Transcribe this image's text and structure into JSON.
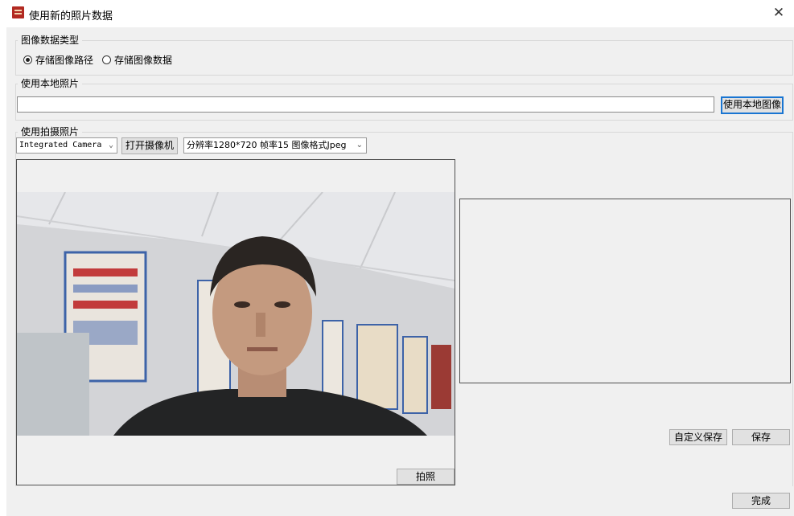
{
  "window": {
    "title": "使用新的照片数据",
    "close_glyph": "✕"
  },
  "image_type_group": {
    "legend": "图像数据类型",
    "options": [
      {
        "label": "存储图像路径",
        "checked": true
      },
      {
        "label": "存储图像数据",
        "checked": false
      }
    ]
  },
  "local_group": {
    "legend": "使用本地照片",
    "path_value": "",
    "button_label": "使用本地图像"
  },
  "capture_group": {
    "legend": "使用拍摄照片",
    "camera_select": "Integrated Camera",
    "open_camera_label": "打开摄像机",
    "format_select": "分辨率1280*720 帧率15 图像格式Jpeg",
    "capture_label": "拍照",
    "custom_save_label": "自定义保存",
    "save_label": "保存"
  },
  "footer": {
    "done_label": "完成"
  },
  "icons": {
    "app": "app-logo-icon",
    "close": "close-icon",
    "dropdown": "chevron-down-icon"
  },
  "colors": {
    "dialog_bg": "#f0f0f0",
    "default_button_border": "#1975d2",
    "app_icon": "#b22a22"
  }
}
